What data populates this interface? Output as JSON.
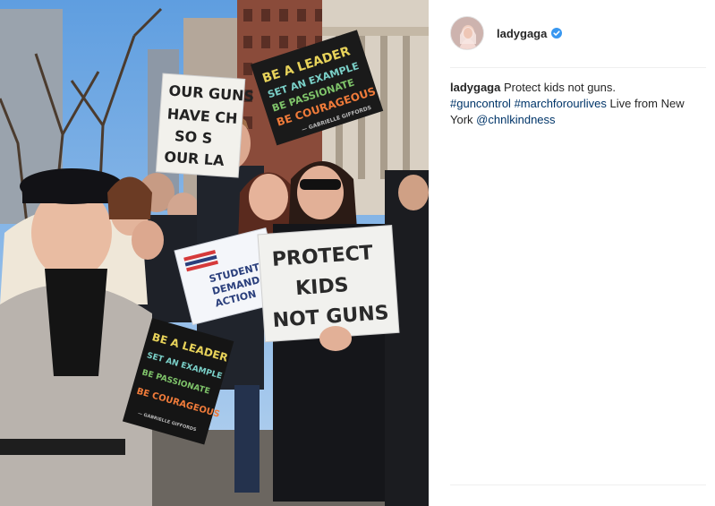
{
  "post": {
    "username": "ladygaga",
    "verified_icon": "verified-badge-icon",
    "accent_color": "#3897f0",
    "caption": {
      "username": "ladygaga",
      "text": "Protect kids not guns.",
      "hashtag_1": "#guncontrol",
      "hashtag_2": "#marchforourlives",
      "text_2": "Live from New York",
      "mention": "@chnlkindness"
    }
  },
  "photo": {
    "sign_top_left": {
      "line_1": "OUR GUNS",
      "line_2": "HAVE CH",
      "line_3": "SO S",
      "line_4": "OUR LA"
    },
    "sign_top_right": {
      "line_1": "BE A LEADER",
      "line_2": "SET AN EXAMPLE",
      "line_3": "BE PASSIONATE",
      "line_4": "BE COURAGEOUS",
      "credit": "— GABRIELLE GIFFORDS"
    },
    "sign_center": {
      "line_1": "PROTECT",
      "line_2": "KIDS",
      "line_3": "NOT GUNS"
    },
    "sign_students": {
      "line_1": "STUDENT",
      "line_2": "DEMAND",
      "line_3": "ACTION"
    },
    "sign_bottom_left": {
      "line_1": "BE A LEADER",
      "line_2": "SET AN EXAMPLE",
      "line_3": "BE PASSIONATE",
      "line_4": "BE COURAGEOUS",
      "credit": "— GABRIELLE GIFFORDS"
    }
  }
}
